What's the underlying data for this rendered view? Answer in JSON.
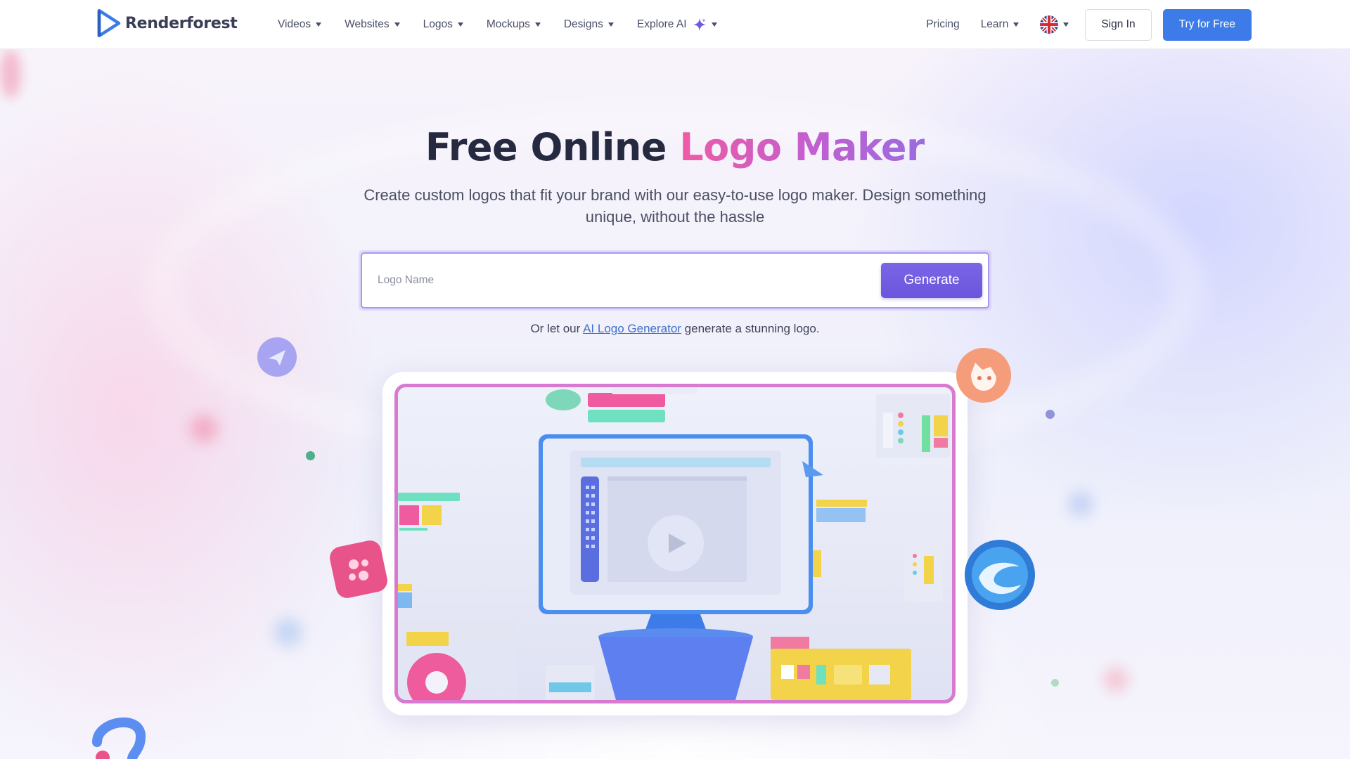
{
  "brand": {
    "name": "Renderforest"
  },
  "nav": {
    "items": [
      {
        "label": "Videos"
      },
      {
        "label": "Websites"
      },
      {
        "label": "Logos"
      },
      {
        "label": "Mockups"
      },
      {
        "label": "Designs"
      },
      {
        "label": "Explore AI"
      }
    ],
    "pricing": "Pricing",
    "learn": "Learn",
    "language_icon": "uk-flag-icon",
    "sign_in": "Sign In",
    "try_free": "Try for Free"
  },
  "hero": {
    "title_main": "Free Online ",
    "title_accent": "Logo Maker",
    "subtitle": "Create custom logos that fit your brand with our easy-to-use logo maker. Design something unique, without the hassle",
    "search_placeholder": "Logo Name",
    "search_value": "",
    "generate_label": "Generate",
    "ai_prefix": "Or let our ",
    "ai_link": "AI Logo Generator",
    "ai_suffix": " generate a stunning logo."
  },
  "colors": {
    "accent": "#3d7ce8",
    "generate": "#6f5ae0",
    "title_gradient_start": "#ef5ba5",
    "title_gradient_end": "#9a6cdf"
  }
}
